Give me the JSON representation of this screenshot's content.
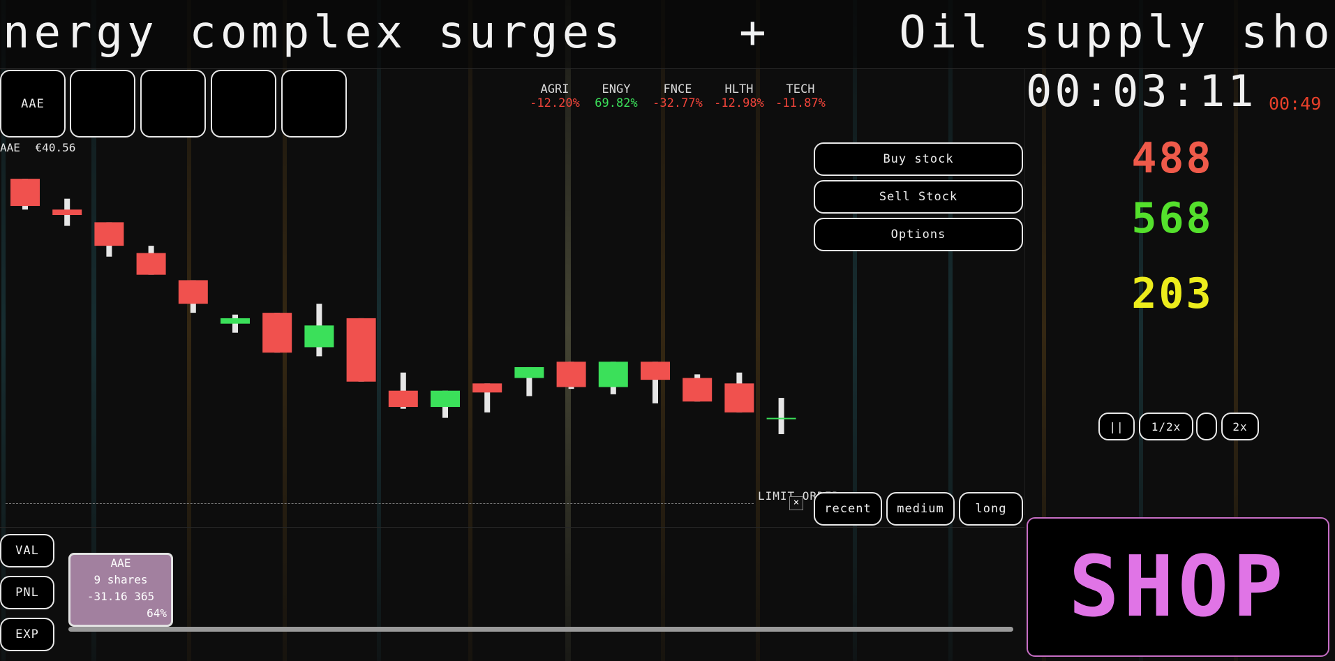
{
  "ticker": {
    "headline_1": "nergy complex surges",
    "separator": "+",
    "headline_2": "Oil supply shock s"
  },
  "slots": [
    "AAE",
    "",
    "",
    "",
    ""
  ],
  "sectors": [
    {
      "name": "AGRI",
      "change": "-12.20%",
      "direction": "down"
    },
    {
      "name": "ENGY",
      "change": "69.82%",
      "direction": "up"
    },
    {
      "name": "FNCE",
      "change": "-32.77%",
      "direction": "down"
    },
    {
      "name": "HLTH",
      "change": "-12.98%",
      "direction": "down"
    },
    {
      "name": "TECH",
      "change": "-11.87%",
      "direction": "down"
    }
  ],
  "timer": {
    "main": "00:03:11",
    "secondary": "00:49"
  },
  "stats": {
    "red": "488",
    "green": "568",
    "yellow": "203"
  },
  "actions": {
    "buy": "Buy stock",
    "sell": "Sell Stock",
    "options": "Options"
  },
  "chart_header": {
    "ticker": "AAE",
    "price": "€40.56"
  },
  "timeframes": [
    "recent",
    "medium",
    "long"
  ],
  "limit_order": {
    "label": "LIMIT ORDER",
    "close": "×"
  },
  "speed": {
    "pause": "||",
    "half": "1/2x",
    "normal": "",
    "double": "2x"
  },
  "left_buttons": [
    "VAL",
    "PNL",
    "EXP"
  ],
  "holding": {
    "ticker": "AAE",
    "shares": "9 shares",
    "pnl": "-31.16",
    "value": "365",
    "percent": "64%"
  },
  "shop_label": "SHOP",
  "colors": {
    "up": "#3be05a",
    "down": "#f0514e",
    "wick": "#e6e6e6",
    "shop": "#e074e6",
    "stat_red": "#ef5a4a",
    "stat_green": "#54e02c",
    "stat_yellow": "#ecec1c"
  },
  "chart_data": {
    "type": "candlestick",
    "series": [
      {
        "open": 9.3,
        "close": 7.8,
        "high": 9.3,
        "low": 7.6
      },
      {
        "open": 7.6,
        "close": 7.3,
        "high": 8.2,
        "low": 6.7
      },
      {
        "open": 6.9,
        "close": 5.6,
        "high": 6.9,
        "low": 5.0
      },
      {
        "open": 5.2,
        "close": 4.0,
        "high": 5.6,
        "low": 4.0
      },
      {
        "open": 3.7,
        "close": 2.4,
        "high": 3.7,
        "low": 1.9
      },
      {
        "open": 1.3,
        "close": 1.6,
        "high": 1.8,
        "low": 0.8
      },
      {
        "open": 1.9,
        "close": -0.3,
        "high": 1.9,
        "low": -0.3
      },
      {
        "open": 0.0,
        "close": 1.2,
        "high": 2.4,
        "low": -0.5
      },
      {
        "open": 1.6,
        "close": -1.9,
        "high": 1.6,
        "low": -1.9
      },
      {
        "open": -2.4,
        "close": -3.3,
        "high": -1.4,
        "low": -3.4
      },
      {
        "open": -3.3,
        "close": -2.4,
        "high": -2.4,
        "low": -3.9
      },
      {
        "open": -2.0,
        "close": -2.5,
        "high": -2.0,
        "low": -3.6
      },
      {
        "open": -1.7,
        "close": -1.1,
        "high": -1.1,
        "low": -2.7
      },
      {
        "open": -0.8,
        "close": -2.2,
        "high": -0.8,
        "low": -2.3
      },
      {
        "open": -2.2,
        "close": -0.8,
        "high": -0.8,
        "low": -2.6
      },
      {
        "open": -0.8,
        "close": -1.8,
        "high": -0.8,
        "low": -3.1
      },
      {
        "open": -1.7,
        "close": -3.0,
        "high": -1.5,
        "low": -3.0
      },
      {
        "open": -2.0,
        "close": -3.6,
        "high": -1.4,
        "low": -3.6
      },
      {
        "open": -3.9,
        "close": -3.9,
        "high": -2.8,
        "low": -4.8
      }
    ],
    "ylim": [
      -8,
      10.5
    ]
  }
}
